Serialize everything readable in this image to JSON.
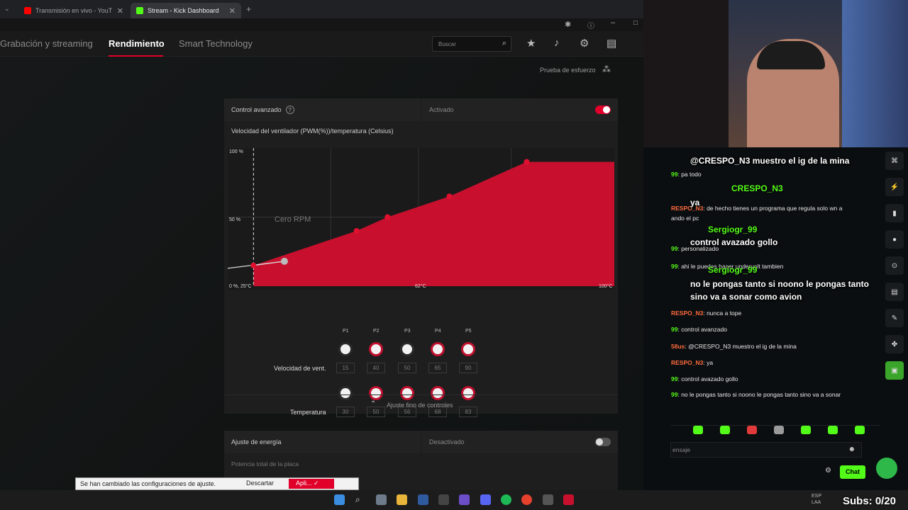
{
  "browser": {
    "tabs": [
      {
        "label": "Transmisión en vivo - YouTube",
        "active": false
      },
      {
        "label": "Stream - Kick Dashboard",
        "active": true
      }
    ]
  },
  "nav": {
    "items": [
      "Grabación y streaming",
      "Rendimiento",
      "Smart Technology"
    ],
    "active": "Rendimiento",
    "search_placeholder": "Buscar"
  },
  "stress_test": "Prueba de esfuerzo",
  "advanced": {
    "label": "Control avanzado",
    "state": "Activado",
    "enabled": true
  },
  "fan_curve": {
    "title": "Velocidad del ventilador (PWM(%))/temperatura (Celsius)",
    "y_top": "100 %",
    "y_mid": "50 %",
    "x_left": "0 %, 25°C",
    "x_mid": "62°C",
    "x_right": "100°C",
    "zero_rpm": "Cero RPM"
  },
  "chart_data": {
    "type": "area",
    "x": [
      30,
      50,
      56,
      68,
      83
    ],
    "series": [
      {
        "values": [
          15,
          40,
          50,
          65,
          90
        ]
      }
    ],
    "zero_rpm_point": [
      25,
      15
    ]
  },
  "points": {
    "labels": [
      "P1",
      "P2",
      "P3",
      "P4",
      "P5"
    ],
    "speed_label": "Velocidad de vent.",
    "speed_values": [
      "15",
      "40",
      "50",
      "65",
      "90"
    ],
    "temp_label": "Temperatura",
    "temp_values": [
      "30",
      "50",
      "56",
      "68",
      "83"
    ]
  },
  "fine_tune": "Ajuste fino de controles",
  "energy": {
    "label": "Ajuste de energía",
    "state": "Desactivado",
    "enabled": false,
    "sub": "Potencia total de la placa"
  },
  "toast": {
    "message": "Se han cambiado las configuraciones de ajuste.",
    "discard": "Descartar",
    "apply": "Apli..."
  },
  "chat": {
    "overlay": [
      {
        "name": "",
        "text": "@CRESPO_N3 muestro el ig de la mina"
      },
      {
        "name": "CRESPO_N3",
        "text": "ya"
      },
      {
        "name": "Sergiogr_99",
        "text": "control avazado gollo"
      },
      {
        "name": "Sergiogr_99",
        "text": "no le pongas tanto si noono le pongas tanto sino va a sonar como avion"
      }
    ],
    "messages": [
      {
        "user": "99",
        "text": ": pa todo"
      },
      {
        "user": "RESPO_N3",
        "text": ": de hecho tienes un programa que regula solo wn a"
      },
      {
        "user": "",
        "text": "ando el pc"
      },
      {
        "user": "99",
        "text": ": personalizado"
      },
      {
        "user": "99",
        "text": ": ahi le puedes hacer undervolt tambien"
      },
      {
        "user": "RESPO_N3",
        "text": ": nunca a tope"
      },
      {
        "user": "99",
        "text": ": control avanzado"
      },
      {
        "user": "58us",
        "text": ": @CRESPO_N3 muestro el ig de la mina"
      },
      {
        "user": "RESPO_N3",
        "text": ": ya"
      },
      {
        "user": "99",
        "text": ": control avazado gollo"
      },
      {
        "user": "99",
        "text": ": no le pongas tanto si noono le pongas tanto sino va a sonar"
      }
    ],
    "input_placeholder": "ensaje",
    "chat_button": "Chat",
    "subs": "Subs: 0/20"
  },
  "taskbar": {
    "lang": "ESP",
    "lang2": "LAA"
  }
}
